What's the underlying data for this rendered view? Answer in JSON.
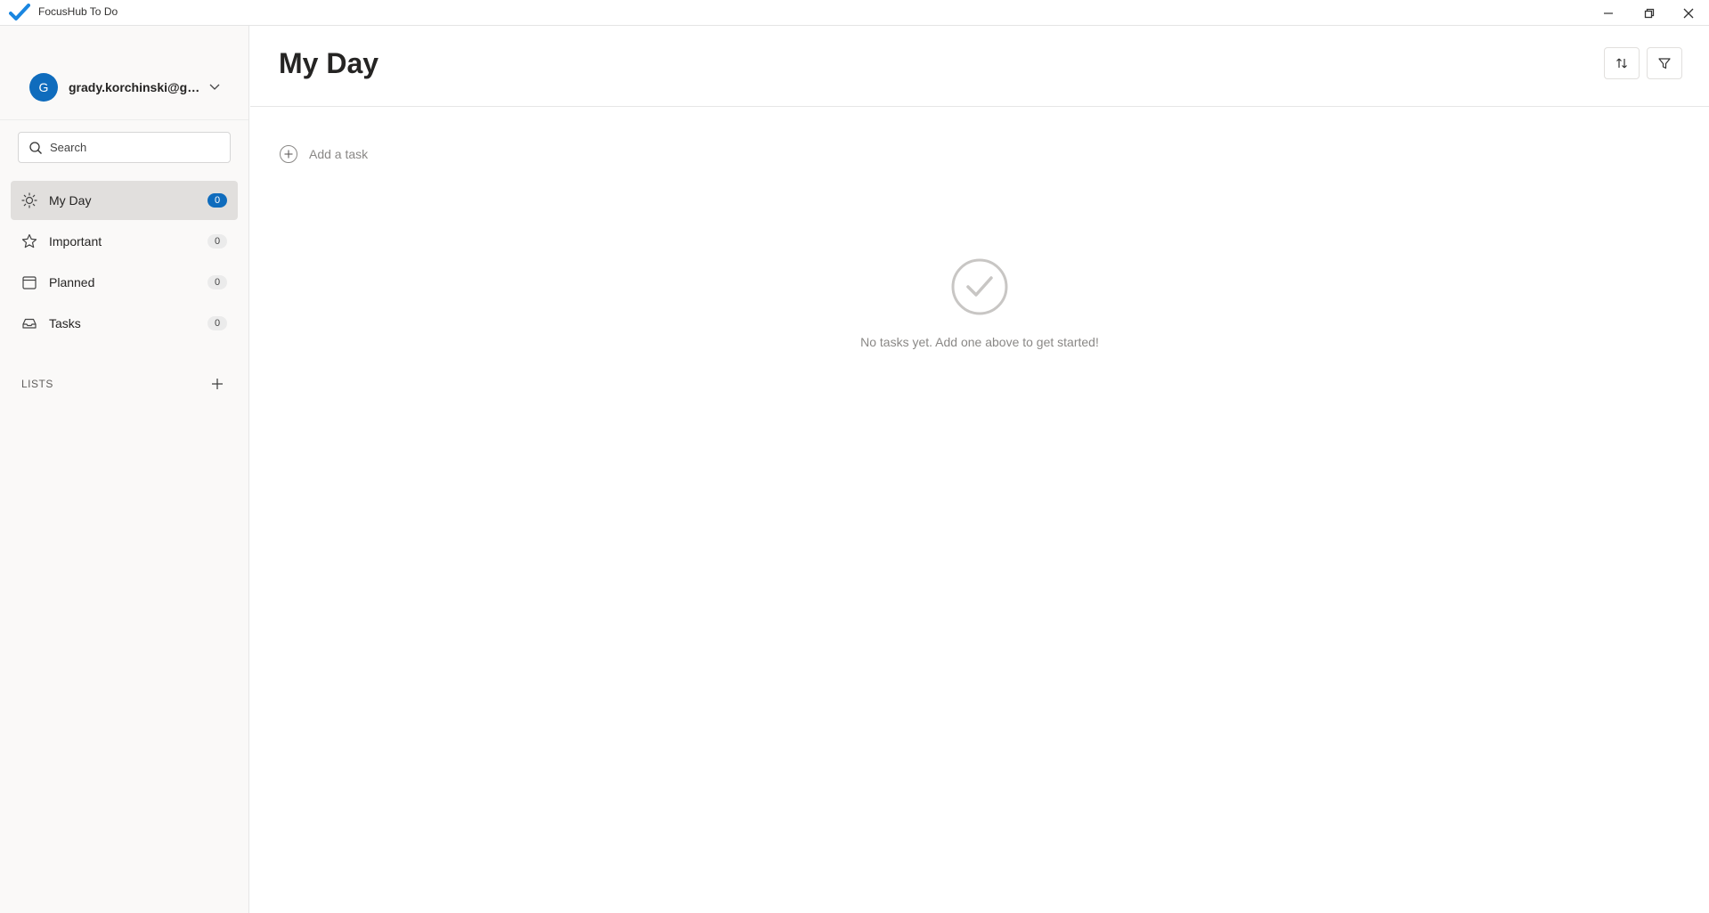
{
  "window": {
    "title": "FocusHub To Do",
    "brand_color": "#1a86e0"
  },
  "account": {
    "initial": "G",
    "name": "grady.korchinski@gm...",
    "avatar_color": "#0f6cbd"
  },
  "search": {
    "placeholder": "Search"
  },
  "nav": {
    "items": [
      {
        "label": "My Day",
        "count": "0",
        "icon": "sun-icon",
        "active": true
      },
      {
        "label": "Important",
        "count": "0",
        "icon": "star-icon",
        "active": false
      },
      {
        "label": "Planned",
        "count": "0",
        "icon": "calendar-icon",
        "active": false
      },
      {
        "label": "Tasks",
        "count": "0",
        "icon": "inbox-icon",
        "active": false
      }
    ]
  },
  "lists": {
    "label": "LISTS"
  },
  "main": {
    "title": "My Day",
    "add_task_placeholder": "Add a task",
    "empty_message": "No tasks yet. Add one above to get started!"
  },
  "colors": {
    "accent": "#0f6cbd",
    "sidebar_bg": "#faf9f8",
    "active_item_bg": "#e1dfdd"
  }
}
